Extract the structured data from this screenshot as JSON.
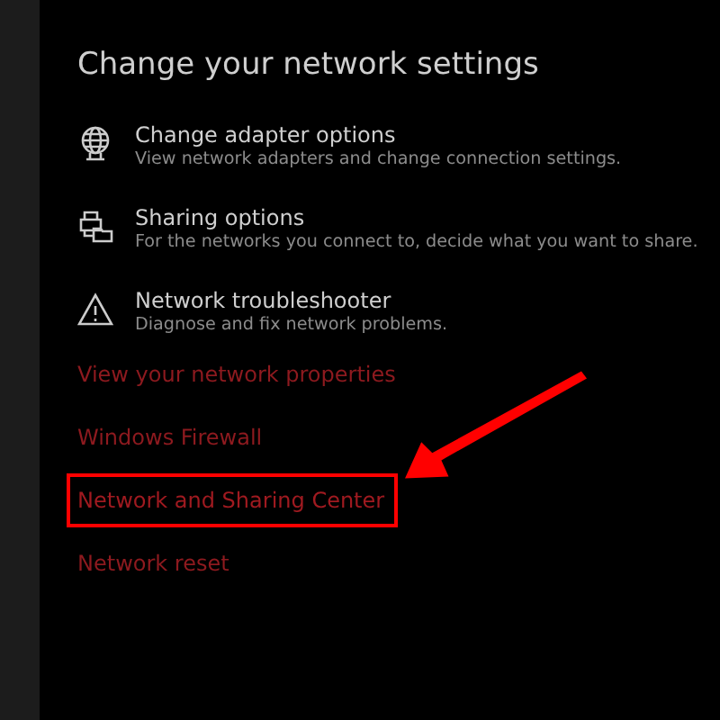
{
  "heading": "Change your network settings",
  "options": [
    {
      "kind": "adapter",
      "title": "Change adapter options",
      "description": "View network adapters and change connection settings."
    },
    {
      "kind": "sharing",
      "title": "Sharing options",
      "description": "For the networks you connect to, decide what you want to share."
    },
    {
      "kind": "troubleshooter",
      "title": "Network troubleshooter",
      "description": "Diagnose and fix network problems."
    }
  ],
  "links": [
    {
      "label": "View your network properties",
      "highlighted": false
    },
    {
      "label": "Windows Firewall",
      "highlighted": false
    },
    {
      "label": "Network and Sharing Center",
      "highlighted": true
    },
    {
      "label": "Network reset",
      "highlighted": false
    }
  ]
}
